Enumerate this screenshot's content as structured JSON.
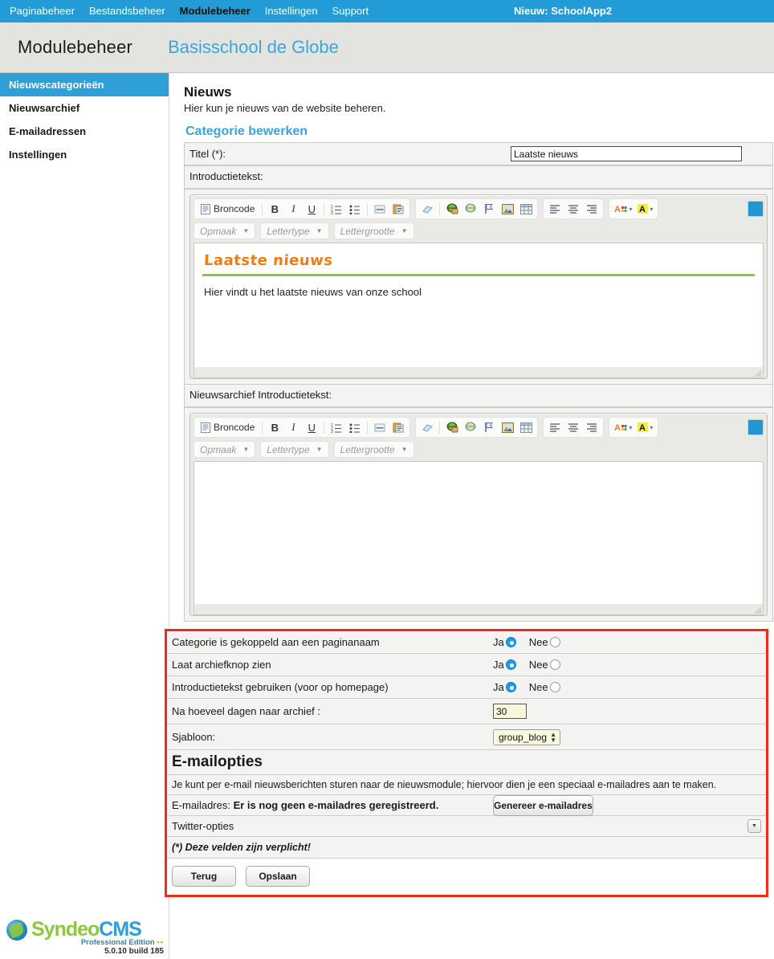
{
  "topnav": {
    "items": [
      {
        "label": "Paginabeheer",
        "active": false
      },
      {
        "label": "Bestandsbeheer",
        "active": false
      },
      {
        "label": "Modulebeheer",
        "active": true
      },
      {
        "label": "Instellingen",
        "active": false
      },
      {
        "label": "Support",
        "active": false
      }
    ],
    "notice": "Nieuw: SchoolApp2"
  },
  "header": {
    "module": "Modulebeheer",
    "site": "Basisschool de Globe"
  },
  "sidebar": {
    "items": [
      {
        "label": "Nieuwscategorieën"
      },
      {
        "label": "Nieuwsarchief"
      },
      {
        "label": "E-mailadressen"
      },
      {
        "label": "Instellingen"
      }
    ]
  },
  "page": {
    "title": "Nieuws",
    "subtitle": "Hier kun je nieuws van de website beheren.",
    "section_title": "Categorie bewerken"
  },
  "form": {
    "title_label": "Titel (*):",
    "title_value": "Laatste nieuws",
    "intro_label": "Introductietekst:",
    "archive_intro_label": "Nieuwsarchief Introductietekst:"
  },
  "editor_toolbar": {
    "source_label": "Broncode",
    "bold": "B",
    "italic": "I",
    "underline": "U",
    "numbered_list": "numbered-list-icon",
    "bullet_list": "bullet-list-icon",
    "horizontal_rule": "horizontal-rule-icon",
    "paste_word": "paste-from-word-icon",
    "remove_format": "remove-format-icon",
    "link": "link-icon",
    "unlink": "unlink-icon",
    "anchor": "anchor-flag-icon",
    "image": "image-icon",
    "table": "table-icon",
    "align_left": "align-left-icon",
    "align_center": "align-center-icon",
    "align_right": "align-right-icon",
    "text_color": "text-color-icon",
    "bg_color": "background-color-icon",
    "maximize": "maximize-icon",
    "combos": [
      {
        "label": "Opmaak"
      },
      {
        "label": "Lettertype"
      },
      {
        "label": "Lettergrootte"
      }
    ]
  },
  "editor_content": {
    "heading": "Laatste nieuws",
    "paragraph": "Hier vindt u het laatste nieuws van onze school",
    "archive_heading": "",
    "archive_paragraph": ""
  },
  "options": {
    "rows": [
      {
        "label": "Categorie is gekoppeld aan een paginanaam",
        "type": "radio",
        "yes": "Ja",
        "no": "Nee",
        "selected": "Ja"
      },
      {
        "label": "Laat archiefknop zien",
        "type": "radio",
        "yes": "Ja",
        "no": "Nee",
        "selected": "Ja"
      },
      {
        "label": "Introductietekst gebruiken (voor op homepage)",
        "type": "radio",
        "yes": "Ja",
        "no": "Nee",
        "selected": "Ja"
      },
      {
        "label": "Na hoeveel dagen naar archief :",
        "type": "text",
        "value": "30"
      },
      {
        "label": "Sjabloon:",
        "type": "select",
        "value": "group_blog"
      }
    ]
  },
  "email": {
    "heading": "E-mailopties",
    "note": "Je kunt per e-mail nieuwsberichten sturen naar de nieuwsmodule; hiervoor dien je een speciaal e-mailadres aan te maken.",
    "address_label": "E-mailadres:",
    "address_status": "Er is nog geen e-mailadres geregistreerd.",
    "generate_button": "Genereer e-mailadres"
  },
  "twitter": {
    "label": "Twitter-opties",
    "expand_icon": "chevron-down-icon"
  },
  "required_note": "(*) Deze velden zijn verplicht!",
  "buttons": {
    "back": "Terug",
    "save": "Opslaan"
  },
  "footer": {
    "brand_a": "Syndeo",
    "brand_b": "CMS",
    "edition": "Professional Edition",
    "edition_dots": "••",
    "version": "5.0.10 build 185"
  },
  "colors": {
    "nav_blue": "#239bd7",
    "accent_blue": "#3aa6de",
    "highlight_red": "#f02c12",
    "heading_orange": "#ef7d17",
    "rule_green": "#8dc63f",
    "field_yellow": "#f9f9e0"
  }
}
